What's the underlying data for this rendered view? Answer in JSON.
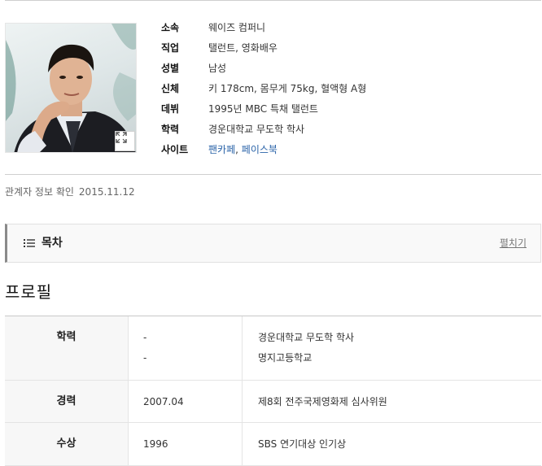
{
  "profile": {
    "photo_alt": "",
    "expand_icon": "expand-icon",
    "fields": [
      {
        "label": "소속",
        "value": "웨이즈 컴퍼니"
      },
      {
        "label": "직업",
        "value": "탤런트, 영화배우"
      },
      {
        "label": "성별",
        "value": "남성"
      },
      {
        "label": "신체",
        "value": "키 178cm, 몸무게 75kg, 혈액형 A형"
      },
      {
        "label": "데뷔",
        "value": "1995년 MBC 특채 탤런트"
      },
      {
        "label": "학력",
        "value": "경운대학교 무도학 학사"
      }
    ],
    "site": {
      "label": "사이트",
      "links": [
        "팬카페",
        "페이스북"
      ],
      "separator": ","
    }
  },
  "verification": {
    "label": "관계자 정보 확인",
    "date": "2015.11.12"
  },
  "toc": {
    "icon": "list-icon",
    "title": "목차",
    "toggle": "펼치기"
  },
  "section": {
    "title": "프로필"
  },
  "profile_table": [
    {
      "category": "학력",
      "periods": [
        "-",
        "-"
      ],
      "details": [
        "경운대학교 무도학 학사",
        "명지고등학교"
      ]
    },
    {
      "category": "경력",
      "periods": [
        "2007.04"
      ],
      "details": [
        "제8회 전주국제영화제 심사위원"
      ]
    },
    {
      "category": "수상",
      "periods": [
        "1996"
      ],
      "details": [
        "SBS 연기대상 인기상"
      ]
    }
  ],
  "colors": {
    "link": "#2a63a8",
    "toc_bar": "#8a8a8a",
    "header_cell_bg": "#f7f7f7"
  }
}
